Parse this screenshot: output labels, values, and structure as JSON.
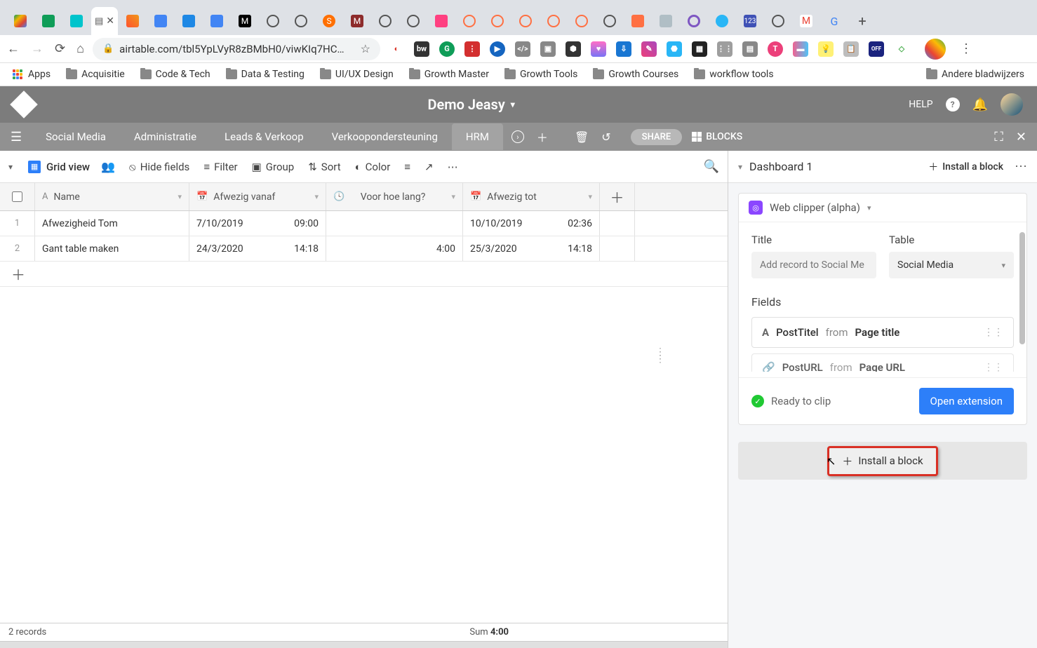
{
  "browser": {
    "url_display": "airtable.com/tbl5YpLVyR8zBMbH0/viwKIq7HC…",
    "bookmarks": {
      "apps": "Apps",
      "items": [
        "Acquisitie",
        "Code & Tech",
        "Data & Testing",
        "UI/UX Design",
        "Growth Master",
        "Growth Tools",
        "Growth Courses",
        "workflow tools"
      ],
      "other": "Andere bladwijzers"
    }
  },
  "app": {
    "title": "Demo Jeasy",
    "help": "HELP",
    "share": "SHARE",
    "blocks": "BLOCKS",
    "tables": [
      "Social Media",
      "Administratie",
      "Leads & Verkoop",
      "Verkoopondersteuning",
      "HRM"
    ],
    "active_table_index": 4
  },
  "view": {
    "name": "Grid view",
    "toolbar": {
      "hide_fields": "Hide fields",
      "filter": "Filter",
      "group": "Group",
      "sort": "Sort",
      "color": "Color"
    }
  },
  "columns": {
    "name": "Name",
    "afwezig_vanaf": "Afwezig vanaf",
    "voor_hoe_lang": "Voor hoe lang?",
    "afwezig_tot": "Afwezig tot"
  },
  "rows": [
    {
      "num": "1",
      "name": "Afwezigheid Tom",
      "vanaf_date": "7/10/2019",
      "vanaf_time": "09:00",
      "dur": "",
      "tot_date": "10/10/2019",
      "tot_time": "02:36"
    },
    {
      "num": "2",
      "name": "Gant table maken",
      "vanaf_date": "24/3/2020",
      "vanaf_time": "14:18",
      "dur": "4:00",
      "tot_date": "25/3/2020",
      "tot_time": "14:18"
    }
  ],
  "footer": {
    "count": "2 records",
    "sum_label": "Sum",
    "sum_value": "4:00"
  },
  "panel": {
    "dashboard_name": "Dashboard 1",
    "install_top": "Install a block",
    "block_name": "Web clipper (alpha)",
    "title_label": "Title",
    "table_label": "Table",
    "title_placeholder": "Add record to Social Me",
    "table_value": "Social Media",
    "fields_label": "Fields",
    "fields": [
      {
        "icon": "A",
        "name": "PostTitel",
        "from": "from",
        "src": "Page title"
      },
      {
        "icon": "🔗",
        "name": "PostURL",
        "from": "from",
        "src": "Page URL"
      }
    ],
    "ready": "Ready to clip",
    "open_ext": "Open extension",
    "install_block": "Install a block"
  }
}
